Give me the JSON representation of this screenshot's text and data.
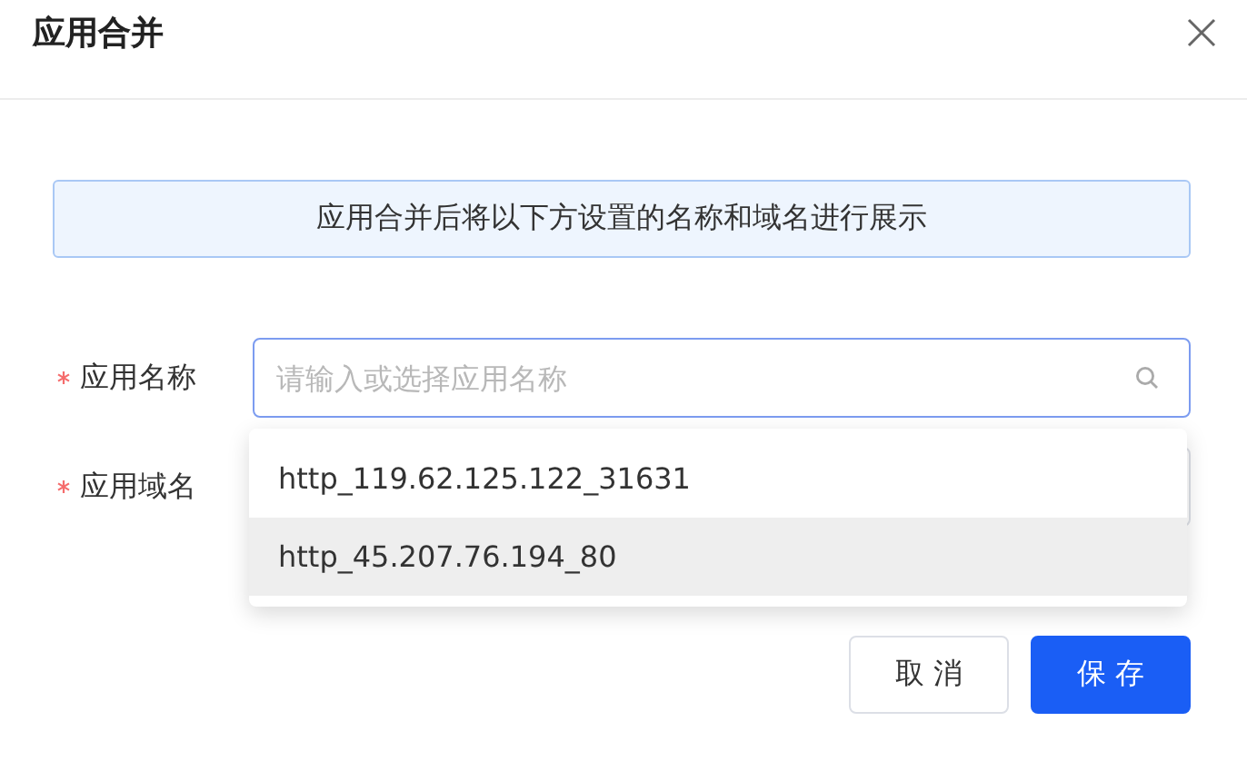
{
  "dialog": {
    "title": "应用合并"
  },
  "notice": "应用合并后将以下方设置的名称和域名进行展示",
  "fields": [
    {
      "label": "应用名称",
      "required": true,
      "placeholder": "请输入或选择应用名称",
      "focused": true
    },
    {
      "label": "应用域名",
      "required": true
    }
  ],
  "dropdown": {
    "options": [
      {
        "label": "http_119.62.125.122_31631",
        "highlighted": false
      },
      {
        "label": "http_45.207.76.194_80",
        "highlighted": true
      }
    ]
  },
  "buttons": [
    {
      "label": "取 消",
      "kind": "secondary"
    },
    {
      "label": "保 存",
      "kind": "primary"
    }
  ]
}
